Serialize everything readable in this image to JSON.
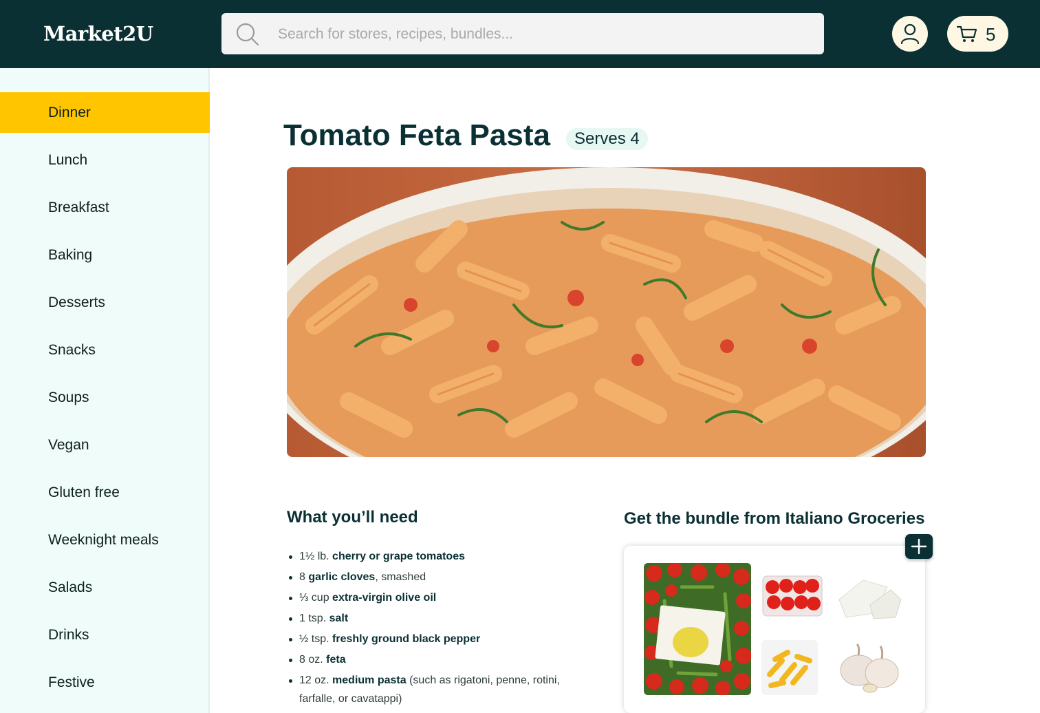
{
  "header": {
    "logo": "Market2U",
    "search_placeholder": "Search for stores, recipes, bundles...",
    "cart_count": "5",
    "icons": [
      "search-icon",
      "user-icon",
      "cart-icon"
    ]
  },
  "sidebar": {
    "items": [
      {
        "label": "Dinner",
        "active": true
      },
      {
        "label": "Lunch"
      },
      {
        "label": "Breakfast"
      },
      {
        "label": "Baking"
      },
      {
        "label": "Desserts"
      },
      {
        "label": "Snacks"
      },
      {
        "label": "Soups"
      },
      {
        "label": "Vegan"
      },
      {
        "label": "Gluten free"
      },
      {
        "label": "Weeknight meals"
      },
      {
        "label": "Salads"
      },
      {
        "label": "Drinks"
      },
      {
        "label": "Festive"
      }
    ]
  },
  "recipe": {
    "title": "Tomato Feta Pasta",
    "serves": "Serves 4",
    "ingredients_heading": "What you’ll need",
    "ingredients": [
      {
        "qty": "1½ lb.",
        "name": "cherry or grape tomatoes",
        "note": ""
      },
      {
        "qty": "8",
        "name": "garlic cloves",
        "note": ", smashed"
      },
      {
        "qty": "⅓ cup",
        "name": "extra-virgin olive oil",
        "note": ""
      },
      {
        "qty": "1 tsp.",
        "name": "salt",
        "note": ""
      },
      {
        "qty": "½ tsp.",
        "name": "freshly ground black pepper",
        "note": ""
      },
      {
        "qty": "8 oz.",
        "name": "feta",
        "note": ""
      },
      {
        "qty": "12 oz.",
        "name": "medium pasta",
        "note": " (such as rigatoni, penne, rotini, farfalle, or cavatappi)"
      }
    ]
  },
  "bundle": {
    "heading": "Get the bundle from Italiano Groceries",
    "items": [
      "baked-feta-dish",
      "cherry-tomatoes",
      "feta-cheese",
      "penne-pasta",
      "garlic"
    ]
  },
  "colors": {
    "header_bg": "#0a3033",
    "accent": "#ffc600",
    "sidebar_bg": "#effcf9",
    "badge_bg": "#e7f7f3",
    "pill_bg": "#fdf7e4"
  }
}
